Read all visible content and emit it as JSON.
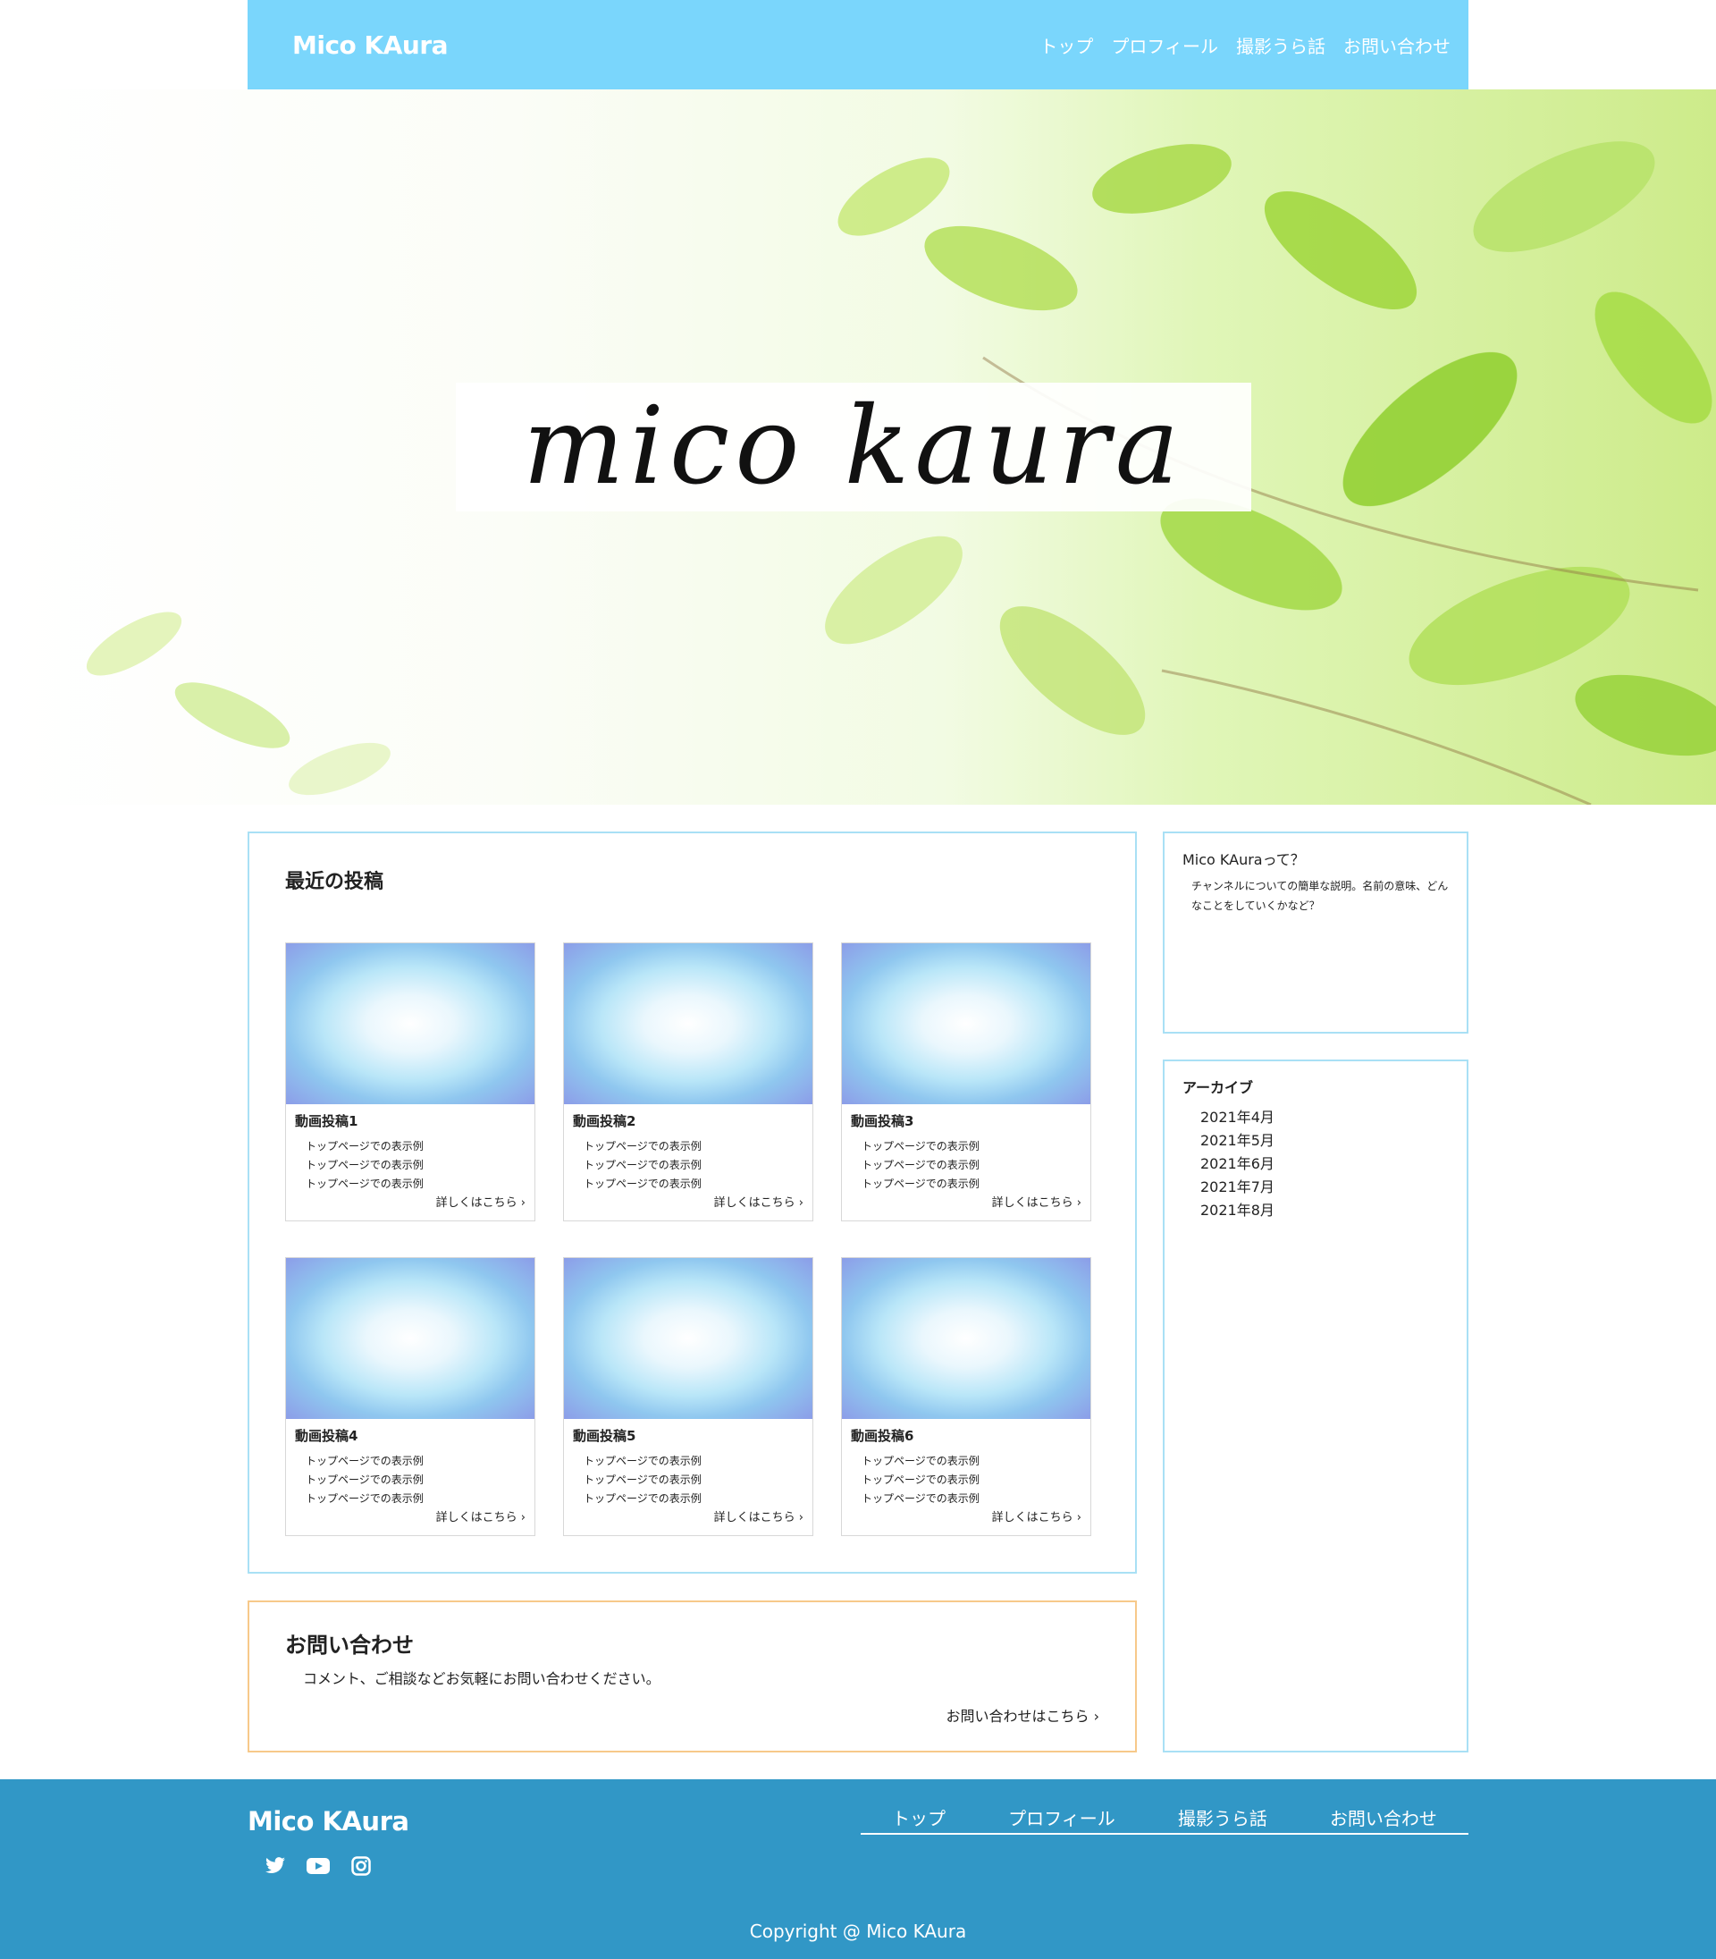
{
  "header": {
    "logo": "Mico KAura",
    "nav": [
      "トップ",
      "プロフィール",
      "撮影うら話",
      "お問い合わせ"
    ]
  },
  "hero": {
    "title": "mico kaura"
  },
  "posts": {
    "heading": "最近の投稿",
    "items": [
      {
        "title": "動画投稿1",
        "lines": [
          "トップページでの表示例",
          "トップページでの表示例",
          "トップページでの表示例"
        ],
        "more": "詳しくはこちら ›"
      },
      {
        "title": "動画投稿2",
        "lines": [
          "トップページでの表示例",
          "トップページでの表示例",
          "トップページでの表示例"
        ],
        "more": "詳しくはこちら ›"
      },
      {
        "title": "動画投稿3",
        "lines": [
          "トップページでの表示例",
          "トップページでの表示例",
          "トップページでの表示例"
        ],
        "more": "詳しくはこちら ›"
      },
      {
        "title": "動画投稿4",
        "lines": [
          "トップページでの表示例",
          "トップページでの表示例",
          "トップページでの表示例"
        ],
        "more": "詳しくはこちら ›"
      },
      {
        "title": "動画投稿5",
        "lines": [
          "トップページでの表示例",
          "トップページでの表示例",
          "トップページでの表示例"
        ],
        "more": "詳しくはこちら ›"
      },
      {
        "title": "動画投稿6",
        "lines": [
          "トップページでの表示例",
          "トップページでの表示例",
          "トップページでの表示例"
        ],
        "more": "詳しくはこちら ›"
      }
    ]
  },
  "contact": {
    "heading": "お問い合わせ",
    "desc": "コメント、ご相談などお気軽にお問い合わせください。",
    "link": "お問い合わせはこちら ›"
  },
  "sidebar": {
    "about_title": "Mico KAuraって？",
    "about_text": "チャンネルについての簡単な説明。名前の意味、どんなことをしていくかなど？",
    "archive_title": "アーカイブ",
    "archive": [
      "2021年4月",
      "2021年5月",
      "2021年6月",
      "2021年7月",
      "2021年8月"
    ]
  },
  "footer": {
    "logo": "Mico KAura",
    "social_icons": [
      "twitter-icon",
      "youtube-icon",
      "instagram-icon"
    ],
    "nav": [
      "トップ",
      "プロフィール",
      "撮影うら話",
      "お問い合わせ"
    ],
    "copyright": "Copyright @ Mico KAura"
  },
  "colors": {
    "header_bg": "#7ad6fc",
    "footer_bg": "#3197c6",
    "panel_border": "#a9e0f5",
    "contact_border": "#f7c98a"
  }
}
